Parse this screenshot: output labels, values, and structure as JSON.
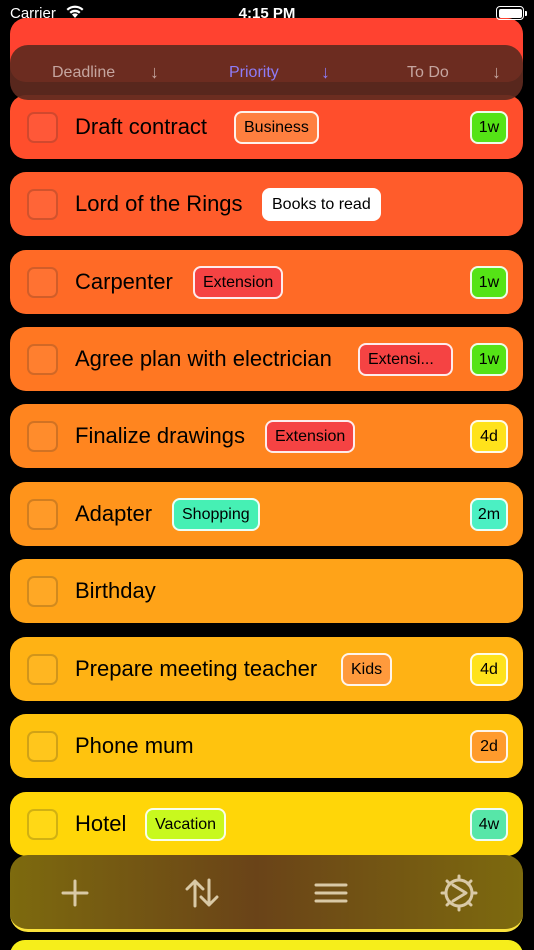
{
  "status_bar": {
    "carrier": "Carrier",
    "time": "4:15 PM"
  },
  "sort_bar": {
    "options": [
      {
        "label": "Deadline",
        "active": false
      },
      {
        "label": "Priority",
        "active": true
      },
      {
        "label": "To Do",
        "active": false
      }
    ]
  },
  "tasks": [
    {
      "title": "Draft contract",
      "tag": "Business",
      "due": "1w"
    },
    {
      "title": "Lord of the Rings",
      "tag": "Books to read",
      "due": ""
    },
    {
      "title": "Carpenter",
      "tag": "Extension",
      "due": "1w"
    },
    {
      "title": "Agree plan with electrician",
      "tag": "Extensi...",
      "due": "1w"
    },
    {
      "title": "Finalize drawings",
      "tag": "Extension",
      "due": "4d"
    },
    {
      "title": "Adapter",
      "tag": "Shopping",
      "due": "2m"
    },
    {
      "title": "Birthday",
      "tag": "",
      "due": ""
    },
    {
      "title": "Prepare meeting teacher",
      "tag": "Kids",
      "due": "4d"
    },
    {
      "title": "Phone mum",
      "tag": "",
      "due": "2d"
    },
    {
      "title": "Hotel",
      "tag": "Vacation",
      "due": "4w"
    }
  ],
  "colors": {
    "row_gradient": [
      "#ff4b2b",
      "#ff5a2b",
      "#ff6a25",
      "#ff7722",
      "#ff861f",
      "#ff961b",
      "#ffa418",
      "#ffb414",
      "#ffc60d",
      "#ffd808"
    ],
    "tag_business": "#ff7d3f",
    "tag_books": "#ffffff",
    "tag_extension": "#f44141",
    "tag_shopping": "#46f0b4",
    "tag_kids": "#ff9a3c",
    "tag_vacation": "#c8f91e",
    "due_1w": "#55e316",
    "due_4d": "#ffe21b",
    "due_2m": "#4bf0c3",
    "due_2d": "#ff9b2c",
    "due_4w": "#57e6a8",
    "sort_active": "#8e7cf6"
  },
  "toolbar": {
    "icons": [
      "plus-icon",
      "sort-arrows-icon",
      "menu-icon",
      "settings-icon"
    ]
  }
}
